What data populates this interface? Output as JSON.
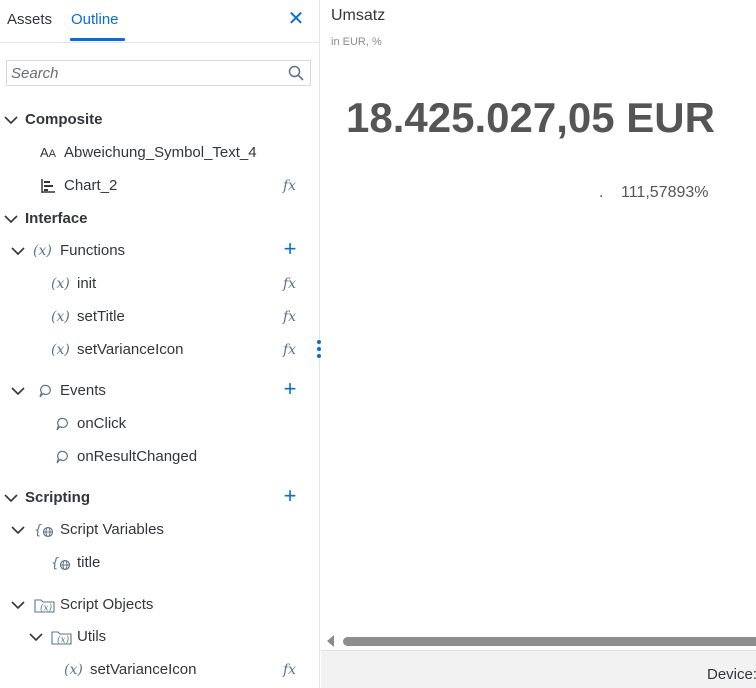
{
  "tabs": {
    "assets": "Assets",
    "outline": "Outline"
  },
  "search": {
    "placeholder": "Search"
  },
  "tree": {
    "composite": "Composite",
    "symbol_text": "Abweichung_Symbol_Text_4",
    "chart": "Chart_2",
    "interface": "Interface",
    "functions": "Functions",
    "fn_init": "init",
    "fn_settitle": "setTitle",
    "fn_setvariance": "setVarianceIcon",
    "events": "Events",
    "ev_onclick": "onClick",
    "ev_onresult": "onResultChanged",
    "scripting": "Scripting",
    "script_variables": "Script Variables",
    "var_title": "title",
    "script_objects": "Script Objects",
    "utils": "Utils",
    "utils_setvariance": "setVarianceIcon",
    "fx_label": "fx"
  },
  "widget": {
    "title": "Umsatz",
    "subtitle": "in EUR, %",
    "value": "18.425.027,05 EUR",
    "dot": ".",
    "percent": "111,57893%"
  },
  "status": {
    "device": "Device:"
  },
  "colors": {
    "accent": "#0a6ed1",
    "icon": "#5b738b",
    "value": "#555555"
  }
}
